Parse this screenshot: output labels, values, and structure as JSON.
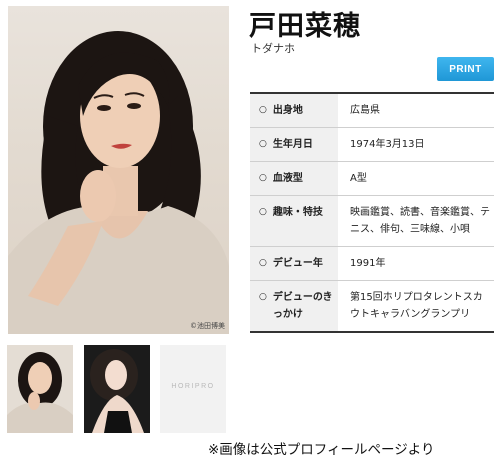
{
  "profile": {
    "name": "戸田菜穂",
    "kana": "トダナホ",
    "photo_credit": "©池田博美",
    "print_label": "PRINT",
    "rows": [
      {
        "label": "出身地",
        "value": "広島県"
      },
      {
        "label": "生年月日",
        "value": "1974年3月13日"
      },
      {
        "label": "血液型",
        "value": "A型"
      },
      {
        "label": "趣味・特技",
        "value": "映画鑑賞、読書、音楽鑑賞、テニス、俳句、三味線、小唄"
      },
      {
        "label": "デビュー年",
        "value": "1991年"
      },
      {
        "label": "デビューのきっかけ",
        "value": "第15回ホリプロタレントスカウトキャラバングランプリ"
      }
    ],
    "bullet": "○"
  },
  "thumbnails": {
    "logo_text": "HORIPRO"
  },
  "caption": "※画像は公式プロフィールページより",
  "colors": {
    "print_button": "#2aa6e3",
    "label_bg": "#f0f0f0",
    "rule": "#333333"
  }
}
